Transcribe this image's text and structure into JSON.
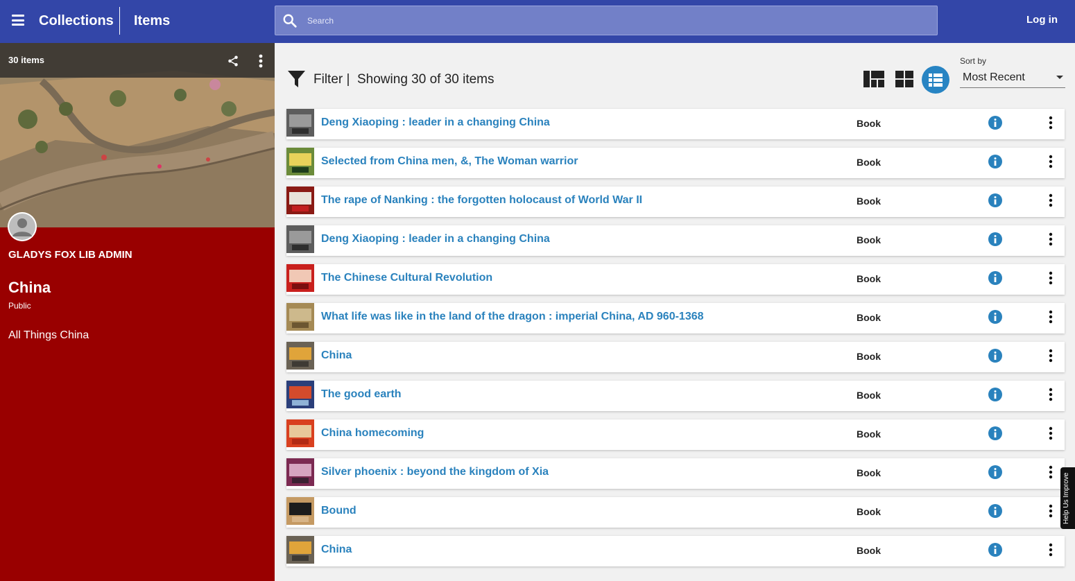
{
  "header": {
    "app_title": "Collections",
    "section_title": "Items",
    "search_placeholder": "Search",
    "login_label": "Log in",
    "accent_color": "#3346a8"
  },
  "collection": {
    "item_count": "30 items",
    "owner": "GLADYS FOX LIB ADMIN",
    "title": "China",
    "visibility": "Public",
    "description": "All Things China",
    "panel_color": "#990000"
  },
  "toolbar": {
    "filter_label": "Filter |",
    "showing_text": "Showing 30 of 30 items",
    "sort_label": "Sort by",
    "sort_value": "Most Recent",
    "active_view": "list"
  },
  "items": [
    {
      "title": "Deng Xiaoping : leader in a changing China",
      "type": "Book",
      "thumb": [
        "#5d5d5d",
        "#9a9a9a",
        "#2e2e2e"
      ]
    },
    {
      "title": "Selected from China men, &, The Woman warrior",
      "type": "Book",
      "thumb": [
        "#6b8b3a",
        "#e8d25a",
        "#1e3d1c"
      ]
    },
    {
      "title": "The rape of Nanking : the forgotten holocaust of World War II",
      "type": "Book",
      "thumb": [
        "#8a1a14",
        "#e9e3da",
        "#c21f1f"
      ]
    },
    {
      "title": "Deng Xiaoping : leader in a changing China",
      "type": "Book",
      "thumb": [
        "#5d5d5d",
        "#9a9a9a",
        "#2e2e2e"
      ]
    },
    {
      "title": "The Chinese Cultural Revolution",
      "type": "Book",
      "thumb": [
        "#c9201d",
        "#f1c8b5",
        "#7a0f0f"
      ]
    },
    {
      "title": "What life was like in the land of the dragon : imperial China, AD 960-1368",
      "type": "Book",
      "thumb": [
        "#a58a55",
        "#cdb98c",
        "#6c5631"
      ]
    },
    {
      "title": "China",
      "type": "Book",
      "thumb": [
        "#6a6255",
        "#e0a43a",
        "#3e3a34"
      ]
    },
    {
      "title": "The good earth",
      "type": "Book",
      "thumb": [
        "#2b3f7a",
        "#d44b2c",
        "#8fb2d6"
      ]
    },
    {
      "title": "China homecoming",
      "type": "Book",
      "thumb": [
        "#d9401f",
        "#e8c89a",
        "#b22a14"
      ]
    },
    {
      "title": "Silver phoenix : beyond the kingdom of Xia",
      "type": "Book",
      "thumb": [
        "#7c2a52",
        "#d6a4c0",
        "#3b2032"
      ]
    },
    {
      "title": "Bound",
      "type": "Book",
      "thumb": [
        "#c59a63",
        "#1c1c1c",
        "#d8b588"
      ]
    },
    {
      "title": "China",
      "type": "Book",
      "thumb": [
        "#6a6255",
        "#e0a43a",
        "#3e3a34"
      ]
    }
  ],
  "feedback_label": "Help Us Improve"
}
